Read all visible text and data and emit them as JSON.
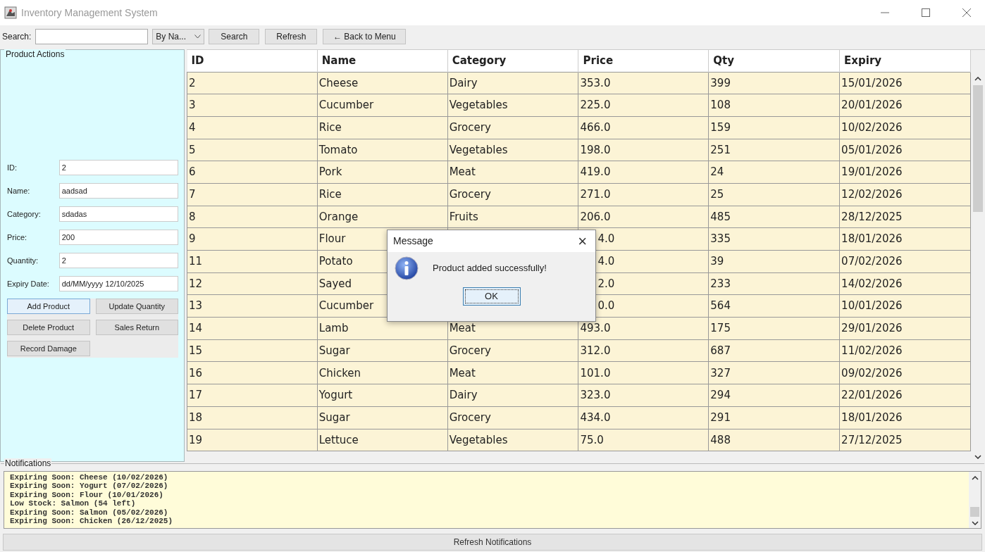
{
  "window": {
    "title": "Inventory Management System"
  },
  "toolbar": {
    "search_label": "Search:",
    "filter": "By Na...",
    "buttons": [
      "Search",
      "Refresh",
      "← Back to Menu"
    ]
  },
  "product_actions": {
    "title": "Product Actions",
    "fields": [
      {
        "label": "ID:",
        "value": "2"
      },
      {
        "label": "Name:",
        "value": "aadsad"
      },
      {
        "label": "Category:",
        "value": "sdadas"
      },
      {
        "label": "Price:",
        "value": "200"
      },
      {
        "label": "Quantity:",
        "value": "2"
      },
      {
        "label": "Expiry Date:",
        "value": "dd/MM/yyyy 12/10/2025"
      }
    ],
    "buttons": [
      {
        "label": "Add Product",
        "focused": true
      },
      {
        "label": "Update Quantity",
        "focused": false
      },
      {
        "label": "Delete Product",
        "focused": false
      },
      {
        "label": "Sales Return",
        "focused": false
      },
      {
        "label": "Record Damage",
        "focused": false
      }
    ]
  },
  "table": {
    "columns": [
      "ID",
      "Name",
      "Category",
      "Price",
      "Qty",
      "Expiry"
    ],
    "rows": [
      {
        "covered": false,
        "cells": [
          "2",
          "Cheese",
          "Dairy",
          "353.0",
          "399",
          "15/01/2026"
        ]
      },
      {
        "covered": false,
        "cells": [
          "3",
          "Cucumber",
          "Vegetables",
          "225.0",
          "108",
          "20/01/2026"
        ]
      },
      {
        "covered": false,
        "cells": [
          "4",
          "Rice",
          "Grocery",
          "466.0",
          "159",
          "10/02/2026"
        ]
      },
      {
        "covered": false,
        "cells": [
          "5",
          "Tomato",
          "Vegetables",
          "198.0",
          "251",
          "05/01/2026"
        ]
      },
      {
        "covered": false,
        "cells": [
          "6",
          "Pork",
          "Meat",
          "419.0",
          "24",
          "19/01/2026"
        ]
      },
      {
        "covered": false,
        "cells": [
          "7",
          "Rice",
          "Grocery",
          "271.0",
          "25",
          "12/02/2026"
        ]
      },
      {
        "covered": false,
        "cells": [
          "8",
          "Orange",
          "Fruits",
          "206.0",
          "485",
          "28/12/2025"
        ]
      },
      {
        "covered": true,
        "cells": [
          "9",
          "Flour",
          "4.0",
          "335",
          "18/01/2026"
        ]
      },
      {
        "covered": true,
        "cells": [
          "11",
          "Potato",
          "4.0",
          "39",
          "07/02/2026"
        ]
      },
      {
        "covered": true,
        "cells": [
          "12",
          "Sayed",
          "2.0",
          "233",
          "14/02/2026"
        ]
      },
      {
        "covered": true,
        "cells": [
          "13",
          "Cucumber",
          "0.0",
          "564",
          "10/01/2026"
        ]
      },
      {
        "covered": false,
        "cells": [
          "14",
          "Lamb",
          "Meat",
          "493.0",
          "175",
          "29/01/2026"
        ]
      },
      {
        "covered": false,
        "cells": [
          "15",
          "Sugar",
          "Grocery",
          "312.0",
          "687",
          "11/02/2026"
        ]
      },
      {
        "covered": false,
        "cells": [
          "16",
          "Chicken",
          "Meat",
          "101.0",
          "327",
          "09/02/2026"
        ]
      },
      {
        "covered": false,
        "cells": [
          "17",
          "Yogurt",
          "Dairy",
          "323.0",
          "294",
          "22/01/2026"
        ]
      },
      {
        "covered": false,
        "cells": [
          "18",
          "Sugar",
          "Grocery",
          "434.0",
          "291",
          "18/01/2026"
        ]
      },
      {
        "covered": false,
        "cells": [
          "19",
          "Lettuce",
          "Vegetables",
          "75.0",
          "488",
          "27/12/2025"
        ]
      }
    ]
  },
  "notifications": {
    "title": "Notifications",
    "lines": [
      "Expiring Soon: Cheese (10/02/2026)",
      "Expiring Soon: Yogurt (07/02/2026)",
      "Expiring Soon: Flour (10/01/2026)",
      "Low Stock: Salmon (54 left)",
      "Expiring Soon: Salmon (05/02/2026)",
      "Expiring Soon: Chicken (26/12/2025)"
    ],
    "button": "Refresh Notifications"
  },
  "dialog": {
    "title": "Message",
    "close": "×",
    "message": "Product added successfully!",
    "button": "OK"
  }
}
